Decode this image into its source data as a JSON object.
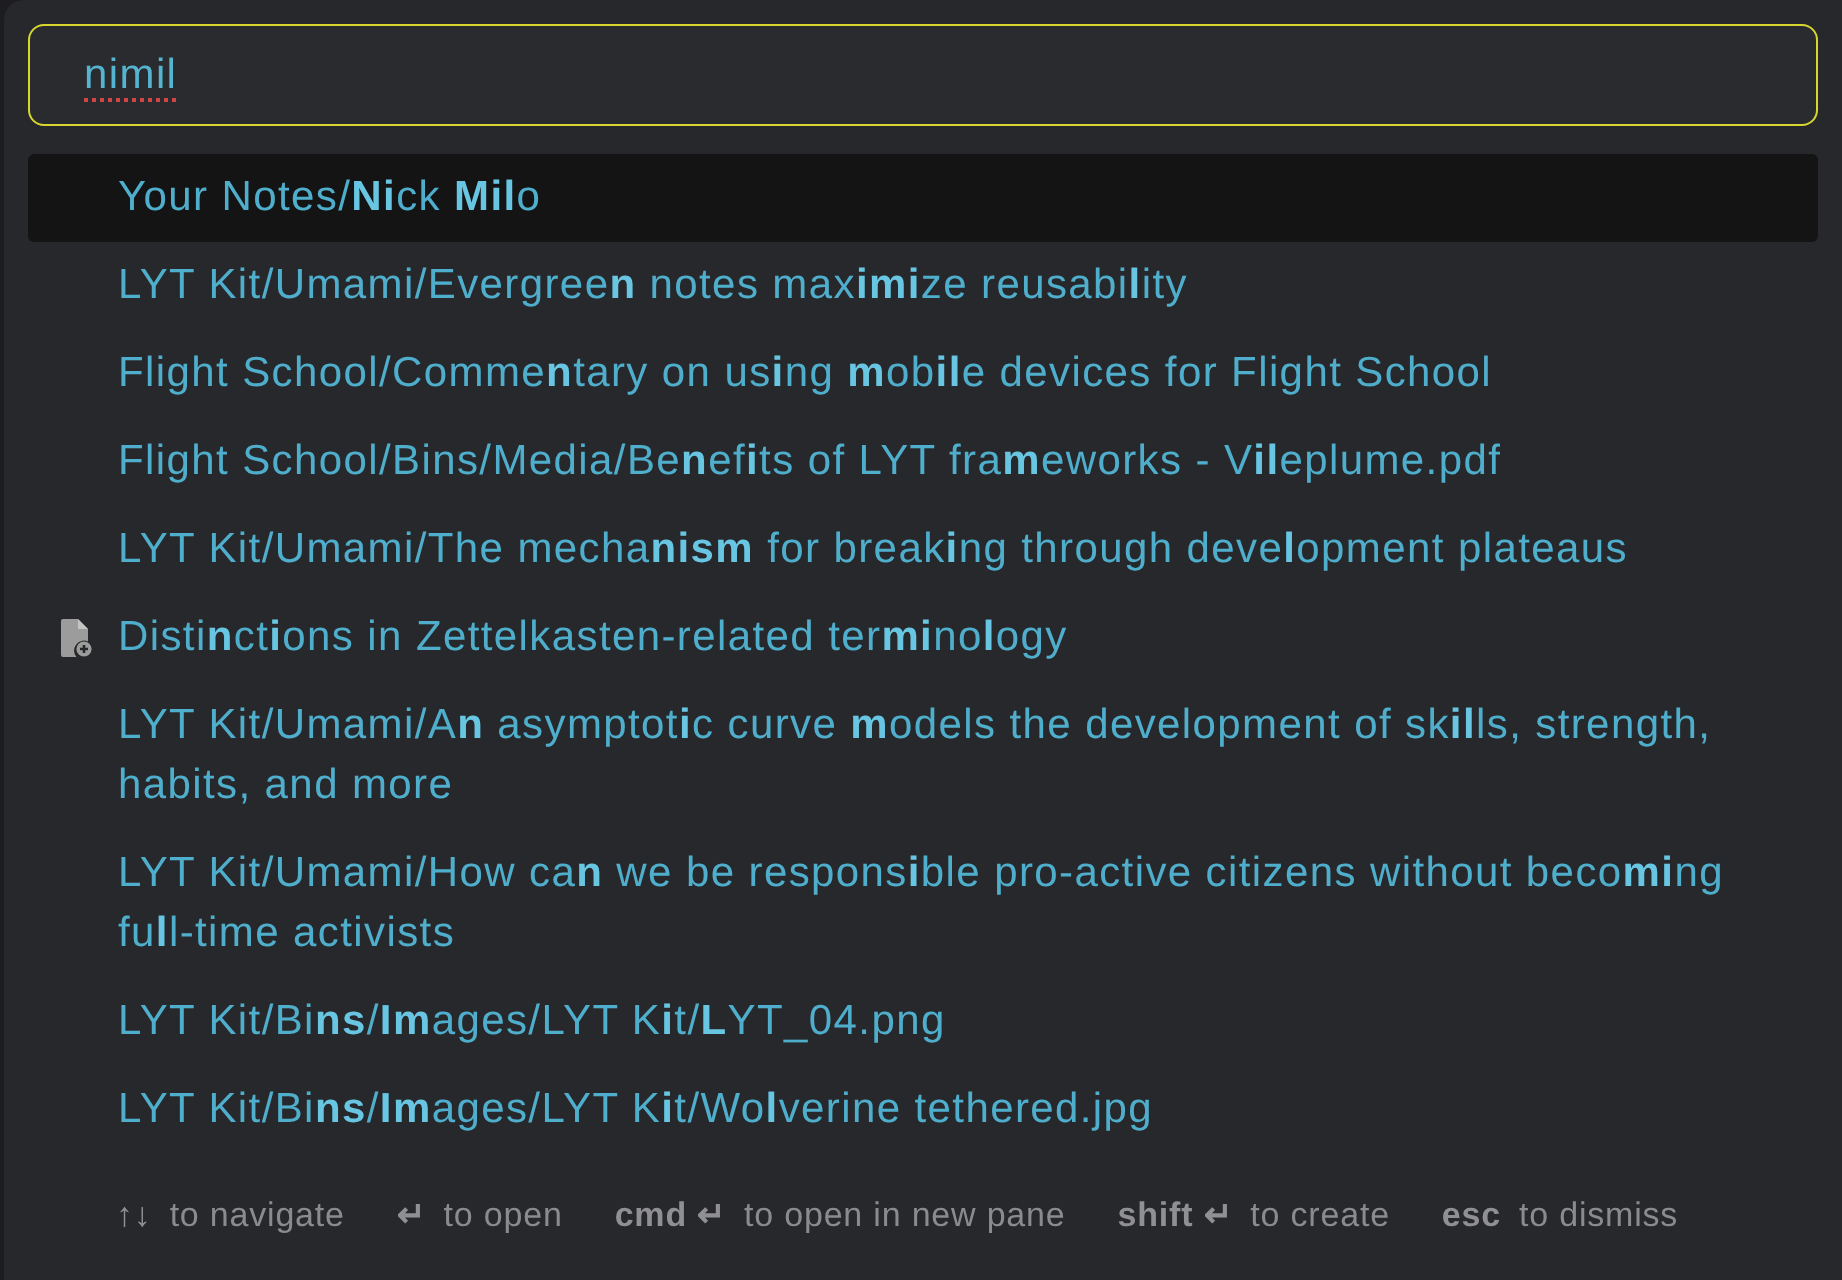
{
  "search": {
    "value": "nimil",
    "spellcheck_error": true
  },
  "results": [
    {
      "title": "Your Notes/**Ni**ck **Mil**o",
      "selected": true,
      "kind": "note"
    },
    {
      "title": "LYT Kit/Umami/Evergree**n** notes max**imi**ze reusabi**l**ity",
      "selected": false,
      "kind": "note"
    },
    {
      "title": "Flight School/Comme**n**tary on us**i**ng **m**ob**il**e devices for Flight School",
      "selected": false,
      "kind": "note"
    },
    {
      "title": "Flight School/Bins/Media/Be**n**ef**i**ts of LYT fra**m**eworks - V**il**eplume.pdf",
      "selected": false,
      "kind": "note"
    },
    {
      "title": "LYT Kit/Umami/The mecha**nism** for break**i**ng through deve**l**opment plateaus",
      "selected": false,
      "kind": "note"
    },
    {
      "title": "Disti**n**ct**i**ons in Zettelkasten-related ter**mi**no**l**ogy",
      "selected": false,
      "kind": "unresolved"
    },
    {
      "title": "LYT Kit/Umami/A**n** asymptot**i**c curve **m**odels the development of sk**il**ls, strength, habits, and more",
      "selected": false,
      "kind": "note"
    },
    {
      "title": "LYT Kit/Umami/How ca**n** we be respons**i**ble pro-active citizens without beco**mi**ng fu**l**l-time activists",
      "selected": false,
      "kind": "note"
    },
    {
      "title": "LYT Kit/Bi**ns**/**Im**ages/LYT K**i**t/**L**YT_04.png",
      "selected": false,
      "kind": "note"
    },
    {
      "title": "LYT Kit/Bi**ns**/**Im**ages/LYT K**i**t/Wo**l**verine tethered.jpg",
      "selected": false,
      "kind": "note"
    }
  ],
  "instructions": [
    {
      "command": "↑↓",
      "purpose": "to navigate"
    },
    {
      "command": "↵",
      "purpose": "to open"
    },
    {
      "command": "cmd ↵",
      "purpose": "to open in new pane"
    },
    {
      "command": "shift ↵",
      "purpose": "to create"
    },
    {
      "command": "esc",
      "purpose": "to dismiss"
    }
  ]
}
